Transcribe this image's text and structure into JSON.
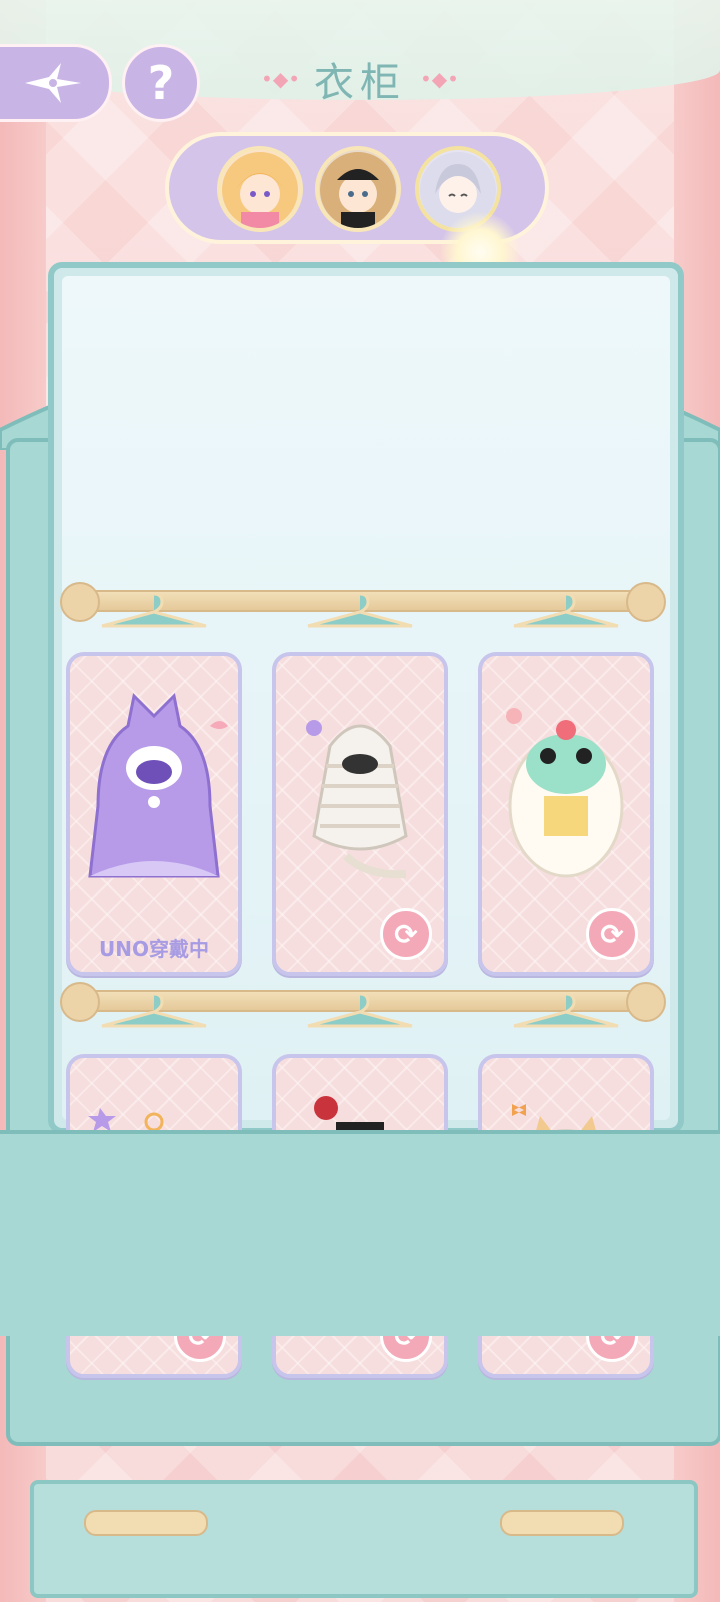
{
  "header": {
    "title": "衣柜",
    "title_left_decoration": "•◆•",
    "title_right_decoration": "•◆•",
    "help_label": "?"
  },
  "characters": [
    {
      "name": "character-1",
      "selected": false
    },
    {
      "name": "character-2",
      "selected": false
    },
    {
      "name": "character-3",
      "selected": true
    }
  ],
  "wardrobe": {
    "shelves": [
      {
        "cards": [
          {
            "costume": "purple-monster-hoodie",
            "status": "UNO穿戴中",
            "refresh": ""
          },
          {
            "costume": "mummy-wrap",
            "status": "",
            "refresh": "⟳"
          },
          {
            "costume": "lion-dance",
            "status": "",
            "refresh": "⟳"
          }
        ]
      },
      {
        "cards": [
          {
            "costume": "yellow-duck-angel",
            "status": "",
            "refresh": "⟳"
          },
          {
            "costume": "rose-bear-magician",
            "status": "",
            "refresh": "⟳"
          },
          {
            "costume": "white-cat-bow",
            "status": "",
            "refresh": "⟳"
          }
        ]
      }
    ]
  },
  "colors": {
    "accent_purple": "#c9b4e6",
    "wardrobe_teal": "#a7d8d3",
    "title_teal": "#7fb6b3",
    "card_pink": "#f7dede",
    "refresh_pink": "#f4a9b8"
  }
}
